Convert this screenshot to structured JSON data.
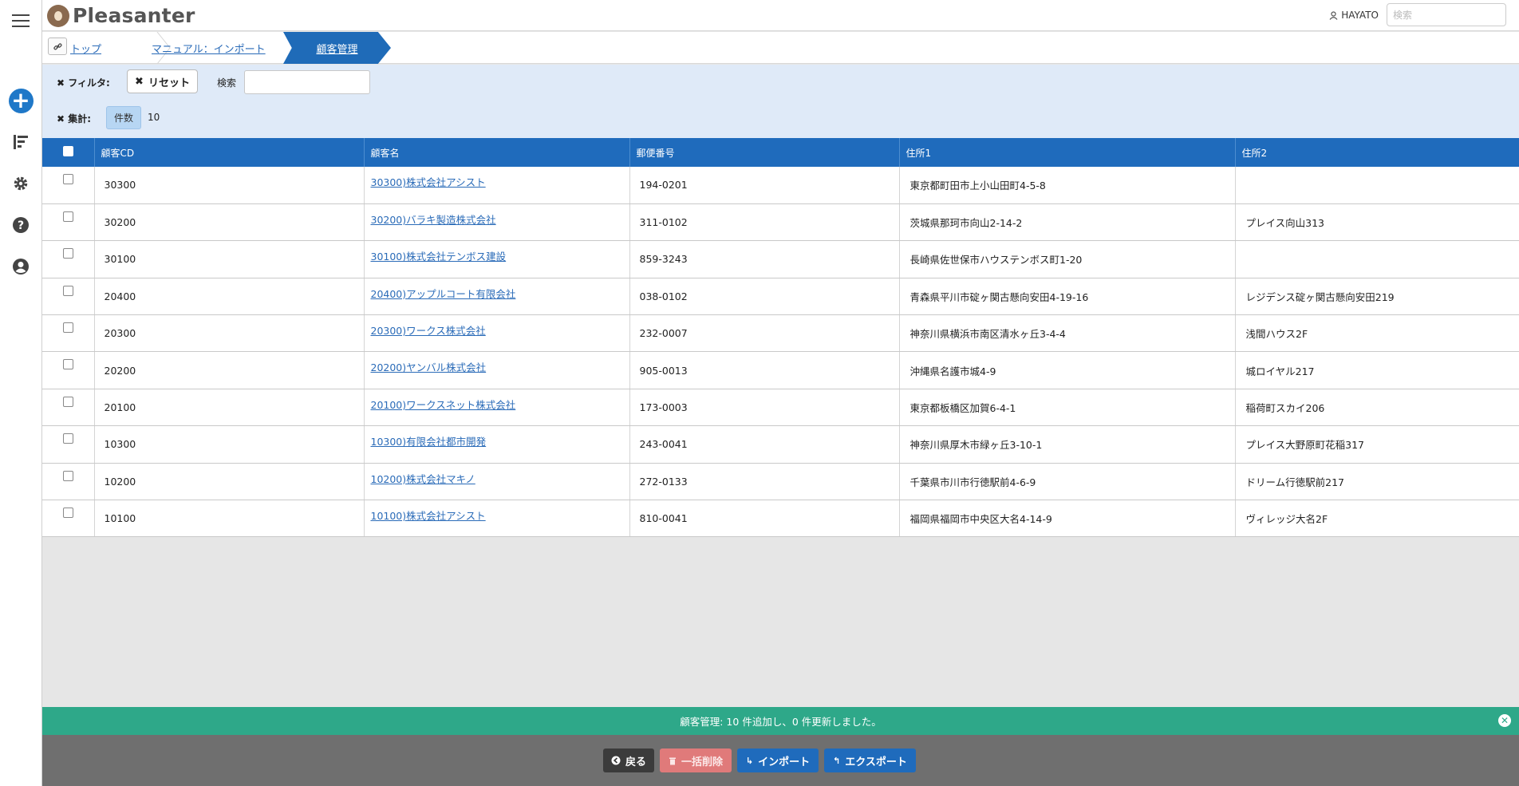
{
  "app": {
    "name": "Pleasanter"
  },
  "header": {
    "user_name": "HAYATO",
    "search_placeholder": "検索"
  },
  "breadcrumb": {
    "items": [
      "トップ",
      "マニュアル：インポート"
    ],
    "active": "顧客管理"
  },
  "filters": {
    "filter_label": "フィルタ:",
    "reset_label": "リセット",
    "search_label": "検索",
    "search_value": "",
    "aggregate_label": "集計:",
    "count_label": "件数",
    "count_value": "10"
  },
  "table": {
    "columns": [
      "顧客CD",
      "顧客名",
      "郵便番号",
      "住所1",
      "住所2"
    ],
    "rows": [
      {
        "cd": "30300",
        "name": "30300)株式会社アシスト",
        "zip": "194-0201",
        "addr1": "東京都町田市上小山田町4-5-8",
        "addr2": ""
      },
      {
        "cd": "30200",
        "name": "30200)バラキ製造株式会社",
        "zip": "311-0102",
        "addr1": "茨城県那珂市向山2-14-2",
        "addr2": "プレイス向山313"
      },
      {
        "cd": "30100",
        "name": "30100)株式会社テンボス建設",
        "zip": "859-3243",
        "addr1": "長崎県佐世保市ハウステンボス町1-20",
        "addr2": ""
      },
      {
        "cd": "20400",
        "name": "20400)アップルコート有限会社",
        "zip": "038-0102",
        "addr1": "青森県平川市碇ヶ関古懸向安田4-19-16",
        "addr2": "レジデンス碇ヶ関古懸向安田219"
      },
      {
        "cd": "20300",
        "name": "20300)ワークス株式会社",
        "zip": "232-0007",
        "addr1": "神奈川県横浜市南区清水ヶ丘3-4-4",
        "addr2": "浅間ハウス2F"
      },
      {
        "cd": "20200",
        "name": "20200)ヤンバル株式会社",
        "zip": "905-0013",
        "addr1": "沖縄県名護市城4-9",
        "addr2": "城ロイヤル217"
      },
      {
        "cd": "20100",
        "name": "20100)ワークスネット株式会社",
        "zip": "173-0003",
        "addr1": "東京都板橋区加賀6-4-1",
        "addr2": "稲荷町スカイ206"
      },
      {
        "cd": "10300",
        "name": "10300)有限会社都市開発",
        "zip": "243-0041",
        "addr1": "神奈川県厚木市緑ヶ丘3-10-1",
        "addr2": "プレイス大野原町花稲317"
      },
      {
        "cd": "10200",
        "name": "10200)株式会社マキノ",
        "zip": "272-0133",
        "addr1": "千葉県市川市行徳駅前4-6-9",
        "addr2": "ドリーム行徳駅前217"
      },
      {
        "cd": "10100",
        "name": "10100)株式会社アシスト",
        "zip": "810-0041",
        "addr1": "福岡県福岡市中央区大名4-14-9",
        "addr2": "ヴィレッジ大名2F"
      }
    ]
  },
  "status": {
    "message": "顧客管理: 10 件追加し、0 件更新しました。"
  },
  "commands": {
    "back": "戻る",
    "bulk_delete": "一括削除",
    "import": "インポート",
    "export": "エクスポート"
  },
  "colors": {
    "primary": "#1f6bbc",
    "success": "#2ea889",
    "danger": "#e07a7a",
    "filter_bg": "#dfeaf8"
  }
}
